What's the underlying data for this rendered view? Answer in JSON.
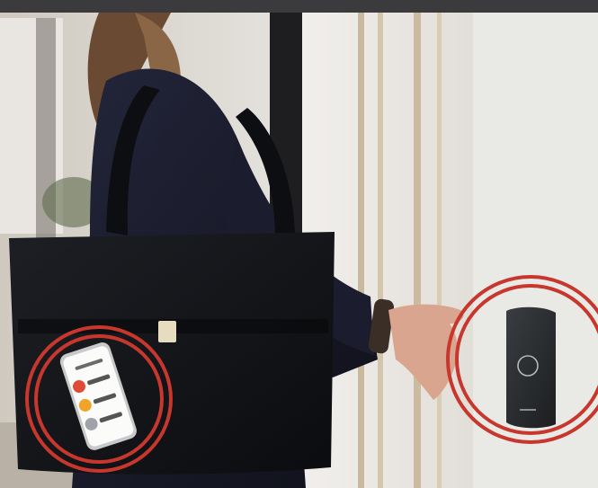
{
  "photo": {
    "subject": "woman-with-handbag",
    "device": "wall-mounted-access-reader",
    "phone": "smartphone-in-bag-pocket"
  },
  "colors": {
    "highlight_ring": "#c8372d",
    "coat": "#161827",
    "bag": "#111318",
    "reader": "#27292c",
    "wall": "#e9e9e6",
    "skin": "#d9a58e",
    "hair": "#6b4a33"
  },
  "phone_screen": {
    "app_rows": [
      {
        "color": "#e14b36"
      },
      {
        "color": "#f0a52a"
      },
      {
        "color": "#9fa3a8"
      }
    ]
  }
}
